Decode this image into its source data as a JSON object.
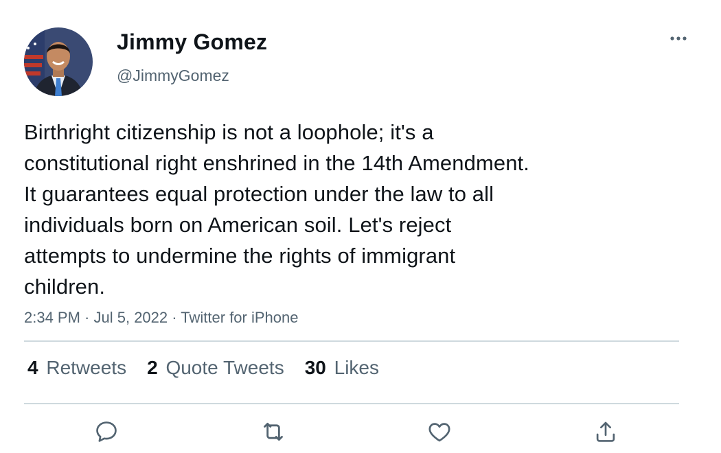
{
  "author": {
    "name": "Jimmy Gomez",
    "handle": "@JimmyGomez",
    "avatar_icon": "profile-photo"
  },
  "tweet": {
    "lines": [
      "Birthright citizenship is not a loophole; it's a",
      "constitutional right enshrined in the 14th Amendment.",
      "It guarantees equal protection under the law to all",
      "individuals born on American soil. Let's reject",
      "attempts to undermine the rights of immigrant",
      "children."
    ],
    "time": "2:34 PM",
    "date": "Jul 5, 2022",
    "source": "Twitter for iPhone",
    "separator": " · "
  },
  "stats": {
    "retweets": {
      "count": "4",
      "label": "Retweets"
    },
    "quote_tweets": {
      "count": "2",
      "label": "Quote Tweets"
    },
    "likes": {
      "count": "30",
      "label": "Likes"
    }
  },
  "actions": {
    "reply_icon": "speech-bubble",
    "retweet_icon": "retweet-arrows",
    "like_icon": "heart",
    "share_icon": "share-upload"
  },
  "colors": {
    "text": "#0f1419",
    "secondary": "#536471",
    "divider": "#cfd9de"
  }
}
